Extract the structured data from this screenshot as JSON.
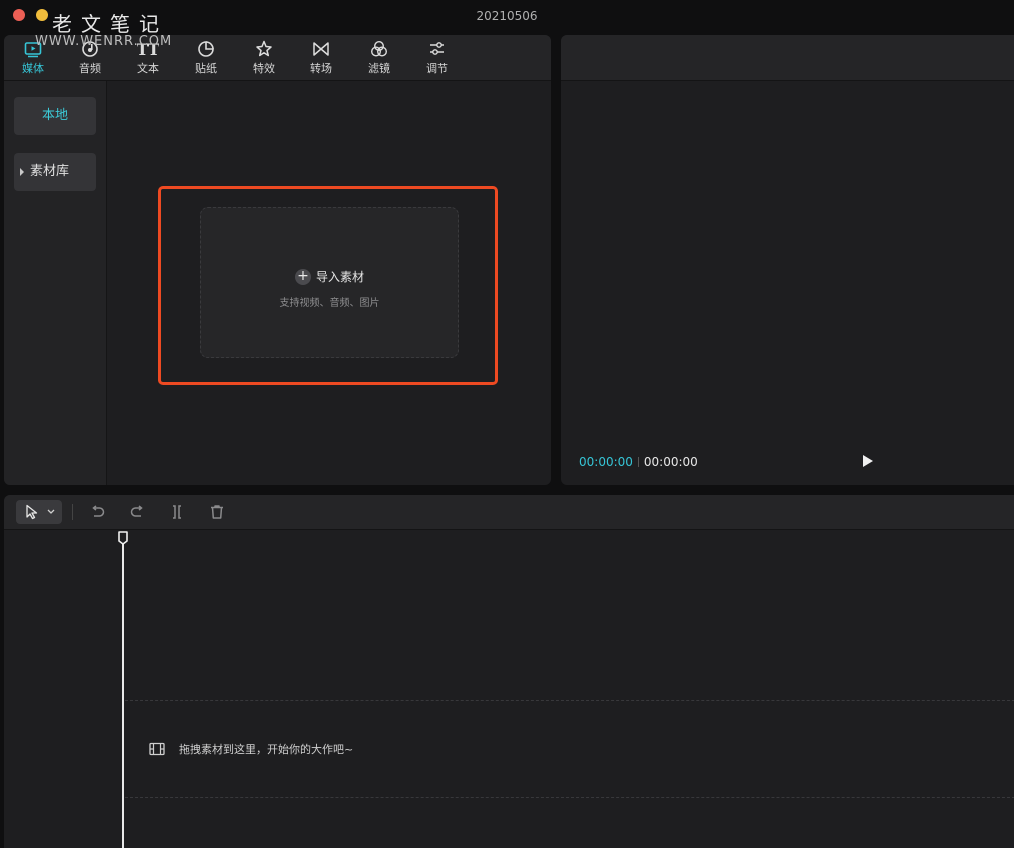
{
  "window": {
    "title": "20210506",
    "watermark_cn": "老文笔记",
    "watermark_en": "WWW.WENRR.COM"
  },
  "media_tabs": [
    {
      "label": "媒体",
      "icon": "media-icon",
      "active": true
    },
    {
      "label": "音频",
      "icon": "audio-icon",
      "active": false
    },
    {
      "label": "文本",
      "icon": "text-icon",
      "active": false
    },
    {
      "label": "贴纸",
      "icon": "sticker-icon",
      "active": false
    },
    {
      "label": "特效",
      "icon": "effects-icon",
      "active": false
    },
    {
      "label": "转场",
      "icon": "transition-icon",
      "active": false
    },
    {
      "label": "滤镜",
      "icon": "filter-icon",
      "active": false
    },
    {
      "label": "调节",
      "icon": "adjust-icon",
      "active": false
    }
  ],
  "sidebar": {
    "local": "本地",
    "library": "素材库"
  },
  "import": {
    "label": "导入素材",
    "hint": "支持视频、音频、图片"
  },
  "player": {
    "current_time": "00:00:00",
    "total_time": "00:00:00"
  },
  "timeline": {
    "drop_hint": "拖拽素材到这里，开始你的大作吧~"
  },
  "colors": {
    "accent": "#36c5d6",
    "highlight": "#ee4a22"
  }
}
